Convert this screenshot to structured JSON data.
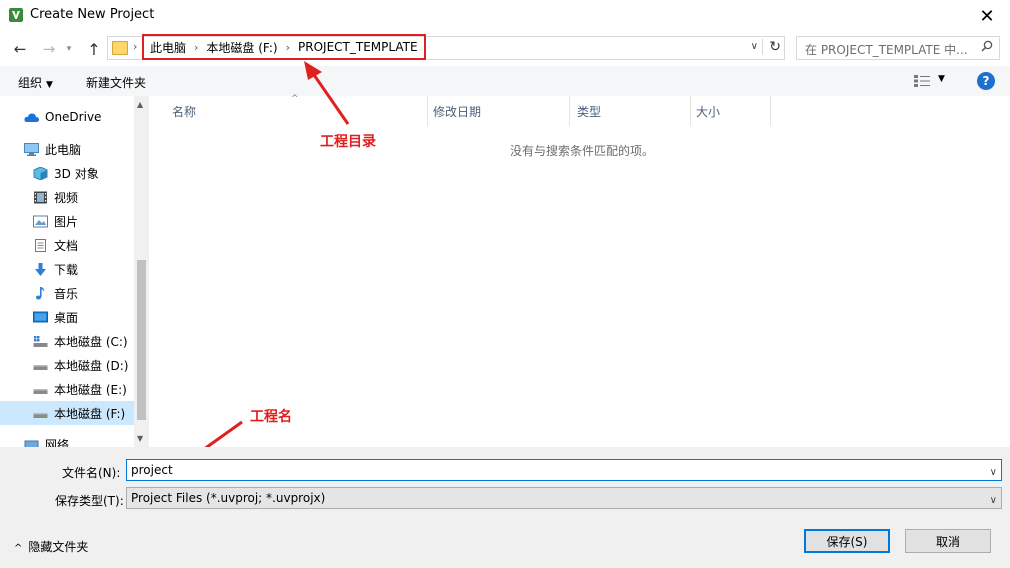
{
  "window": {
    "title": "Create New Project",
    "close_glyph": "✕"
  },
  "nav": {
    "back_glyph": "←",
    "forward_glyph": "→",
    "recent_glyph": "▾",
    "up_glyph": "↑",
    "breadcrumbs": [
      "此电脑",
      "本地磁盘 (F:)",
      "PROJECT_TEMPLATE"
    ],
    "crumb_sep": "›",
    "dropdown_glyph": "∨",
    "refresh_glyph": "↻",
    "search_placeholder": "在 PROJECT_TEMPLATE 中..."
  },
  "toolbar": {
    "organize": "组织",
    "organize_caret": "▼",
    "new_folder": "新建文件夹",
    "view_caret": "▼",
    "help": "?"
  },
  "sidebar": {
    "items": [
      {
        "label": "OneDrive",
        "icon": "cloud-icon"
      },
      {
        "label": "此电脑",
        "icon": "computer-icon"
      },
      {
        "label": "3D 对象",
        "icon": "cube-icon"
      },
      {
        "label": "视频",
        "icon": "film-icon"
      },
      {
        "label": "图片",
        "icon": "picture-icon"
      },
      {
        "label": "文档",
        "icon": "document-icon"
      },
      {
        "label": "下载",
        "icon": "download-icon"
      },
      {
        "label": "音乐",
        "icon": "music-icon"
      },
      {
        "label": "桌面",
        "icon": "desktop-icon"
      },
      {
        "label": "本地磁盘 (C:)",
        "icon": "drive-icon"
      },
      {
        "label": "本地磁盘 (D:)",
        "icon": "drive-icon"
      },
      {
        "label": "本地磁盘 (E:)",
        "icon": "drive-icon"
      },
      {
        "label": "本地磁盘 (F:)",
        "icon": "drive-icon",
        "selected": true
      },
      {
        "label": "网络",
        "icon": "network-icon"
      }
    ],
    "scroll_up": "▲",
    "scroll_down": "▼"
  },
  "filelist": {
    "columns": [
      "名称",
      "修改日期",
      "类型",
      "大小"
    ],
    "sort_glyph": "^",
    "empty_message": "没有与搜索条件匹配的项。"
  },
  "annotations": {
    "dir_label": "工程目录",
    "name_label": "工程名",
    "color": "#e02020"
  },
  "form": {
    "filename_label": "文件名(N):",
    "filename_value": "project",
    "filetype_label": "保存类型(T):",
    "filetype_value": "Project Files (*.uvproj; *.uvprojx)",
    "caret": "∨",
    "hide_folders": "隐藏文件夹",
    "hide_caret": "^",
    "save_button": "保存(S)",
    "cancel_button": "取消"
  }
}
